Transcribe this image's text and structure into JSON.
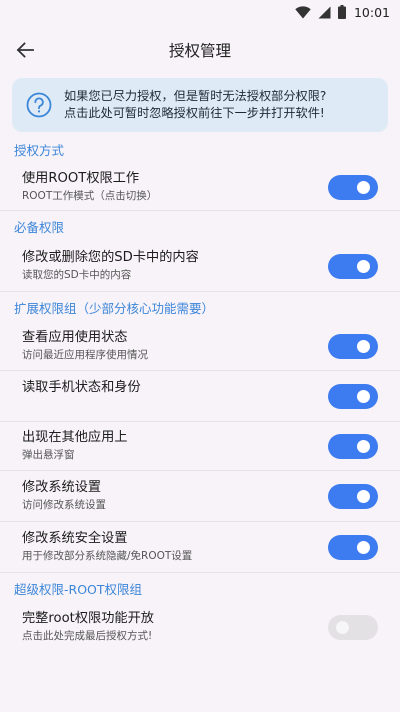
{
  "status": {
    "time": "10:01"
  },
  "appbar": {
    "title": "授权管理"
  },
  "banner": {
    "line1": "如果您已尽力授权，但是暂时无法授权部分权限?",
    "line2": "点击此处可暂时忽略授权前往下一步并打开软件!"
  },
  "sections": {
    "auth_mode": "授权方式",
    "required": "必备权限",
    "extended": "扩展权限组（少部分核心功能需要）",
    "super": "超级权限-ROOT权限组"
  },
  "rows": {
    "root_work": {
      "title": "使用ROOT权限工作",
      "subtitle": "ROOT工作模式（点击切换）",
      "on": true
    },
    "sd_card": {
      "title": "修改或删除您的SD卡中的内容",
      "subtitle": "读取您的SD卡中的内容",
      "on": true
    },
    "usage_stats": {
      "title": "查看应用使用状态",
      "subtitle": "访问最近应用程序使用情况",
      "on": true
    },
    "phone_state": {
      "title": "读取手机状态和身份",
      "subtitle": "",
      "on": true
    },
    "overlay": {
      "title": "出现在其他应用上",
      "subtitle": "弹出悬浮窗",
      "on": true
    },
    "system_settings": {
      "title": "修改系统设置",
      "subtitle": "访问修改系统设置",
      "on": true
    },
    "secure_settings": {
      "title": "修改系统安全设置",
      "subtitle": "用于修改部分系统隐藏/免ROOT设置",
      "on": true
    },
    "root_full": {
      "title": "完整root权限功能开放",
      "subtitle": "点击此处完成最后授权方式!",
      "on": false
    }
  },
  "colors": {
    "accent": "#3d7bf0",
    "section": "#3d86d9",
    "banner_bg": "#dfeaf7"
  },
  "icons": {
    "back": "arrow-left-icon",
    "help": "help-circle-icon",
    "wifi": "wifi-icon",
    "signal": "signal-icon",
    "battery": "battery-icon"
  }
}
